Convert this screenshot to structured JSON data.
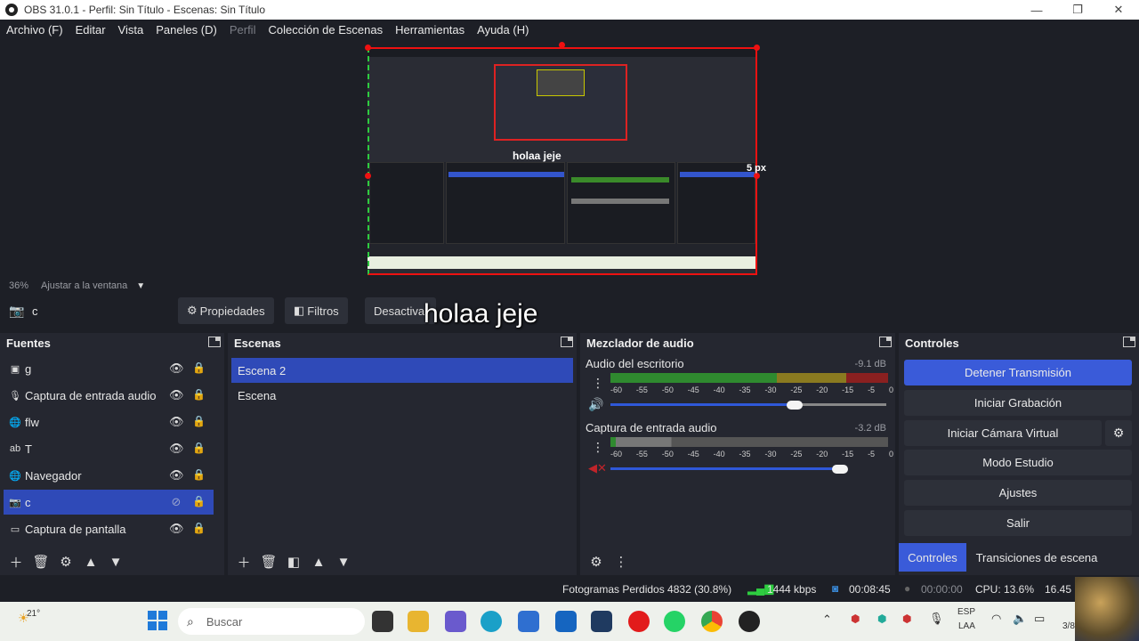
{
  "window": {
    "title": "OBS 31.0.1 - Perfil: Sin Título - Escenas: Sin Título",
    "minimize": "—",
    "maximize": "❐",
    "close": "✕"
  },
  "menu": [
    "Archivo (F)",
    "Editar",
    "Vista",
    "Paneles (D)",
    "Perfil",
    "Colección de Escenas",
    "Herramientas",
    "Ayuda (H)"
  ],
  "preview": {
    "overlay_small": "holaa jeje",
    "px_label": "5 px",
    "zoom": "36%",
    "fit_label": "Ajustar a la ventana"
  },
  "source_toolbar": {
    "selected_source": "c",
    "properties": "Propiedades",
    "filters": "Filtros",
    "deactivate": "Desactiva",
    "overlay_big": "holaa jeje"
  },
  "sources": {
    "title": "Fuentes",
    "items": [
      {
        "name": "g",
        "icon": "image-icon"
      },
      {
        "name": "Captura de entrada audio",
        "icon": "mic-icon"
      },
      {
        "name": "flw",
        "icon": "globe-icon"
      },
      {
        "name": "T",
        "icon": "text-icon"
      },
      {
        "name": "Navegador",
        "icon": "globe-icon"
      },
      {
        "name": "c",
        "icon": "camera-icon"
      },
      {
        "name": "Captura de pantalla",
        "icon": "monitor-icon"
      }
    ]
  },
  "scenes": {
    "title": "Escenas",
    "items": [
      "Escena 2",
      "Escena"
    ]
  },
  "mixer": {
    "title": "Mezclador de audio",
    "tracks": [
      {
        "name": "Audio del escritorio",
        "db": "-9.1 dB",
        "volume": 0.78
      },
      {
        "name": "Captura de entrada audio",
        "db": "-3.2 dB",
        "volume": 0.98
      }
    ],
    "ticks": [
      "-60",
      "-55",
      "-50",
      "-45",
      "-40",
      "-35",
      "-30",
      "-25",
      "-20",
      "-15",
      "-5",
      "0"
    ]
  },
  "controls": {
    "title": "Controles",
    "buttons": [
      "Detener Transmisión",
      "Iniciar Grabación",
      "Iniciar Cámara Virtual",
      "Modo Estudio",
      "Ajustes",
      "Salir"
    ],
    "tabs": [
      "Controles",
      "Transiciones de escena"
    ]
  },
  "status": {
    "dropped": "Fotogramas Perdidos 4832 (30.8%)",
    "bitrate": "1444 kbps",
    "stream_time": "00:08:45",
    "rec_time": "00:00:00",
    "cpu": "CPU: 13.6%",
    "fps": "16.45"
  },
  "taskbar": {
    "weather": "21°",
    "search": "Buscar",
    "lang": "ESP",
    "lang2": "LAA",
    "date": "3/8"
  },
  "colors": {
    "accent": "#3a5bd9",
    "selection": "#2f4ab8",
    "panel_bg": "#252730",
    "window_bg": "#1d1f26"
  }
}
